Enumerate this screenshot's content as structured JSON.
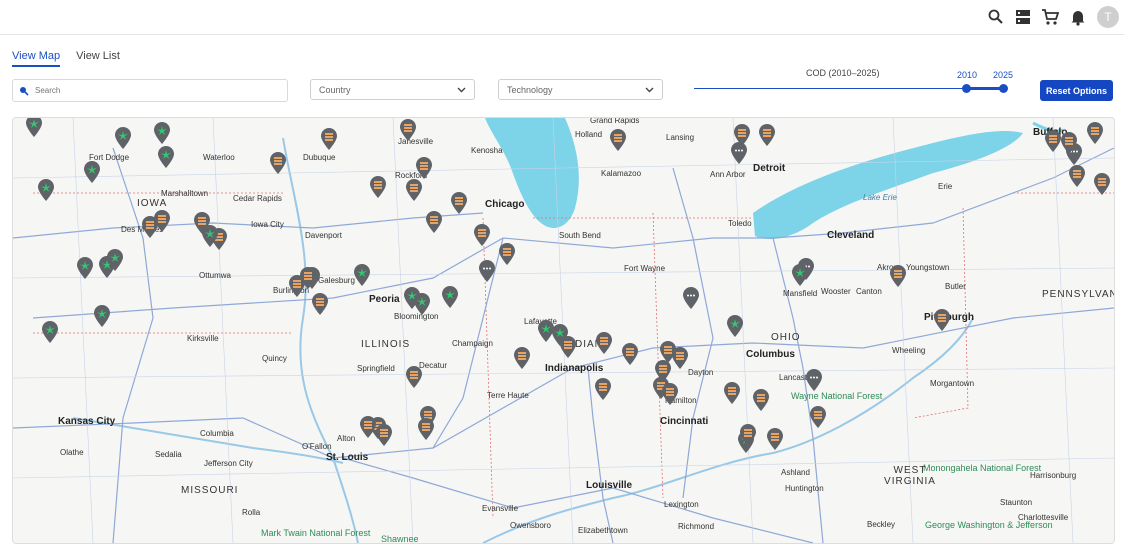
{
  "header": {
    "icons": [
      "search-icon",
      "server-icon",
      "cart-icon",
      "bell-icon"
    ],
    "avatar_initial": "T"
  },
  "tabs": [
    {
      "label": "View Map",
      "active": true
    },
    {
      "label": "View List",
      "active": false
    }
  ],
  "filters": {
    "search_placeholder": "Search",
    "country_label": "Country",
    "technology_label": "Technology",
    "cod_label": "COD (2010–2025)",
    "cod_min": "2010",
    "cod_max": "2025",
    "reset_label": "Reset Options"
  },
  "colors": {
    "accent": "#1a4fc4",
    "pin": "#5f6368",
    "wind_icon": "#2ecc71",
    "factory_icon": "#e8a363",
    "lake": "#7dd3e8"
  },
  "map": {
    "states": [
      "IOWA",
      "ILLINOIS",
      "INDIANA",
      "OHIO",
      "MISSOURI",
      "WEST VIRGINIA",
      "PENNSYLVANIA"
    ],
    "major_cities": [
      "Chicago",
      "Detroit",
      "Cleveland",
      "Indianapolis",
      "Columbus",
      "Cincinnati",
      "Kansas City",
      "St. Louis",
      "Louisville",
      "Pittsburgh"
    ],
    "cities": [
      "Fort Dodge",
      "Waterloo",
      "Dubuque",
      "Janesville",
      "Kenosha",
      "Holland",
      "Grand Rapids",
      "Lansing",
      "Marshalltown",
      "Cedar Rapids",
      "Rockford",
      "Kalamazoo",
      "Ann Arbor",
      "Buffalo",
      "Erie",
      "Des Moines",
      "Iowa City",
      "Davenport",
      "South Bend",
      "Toledo",
      "Ottumwa",
      "Galesburg",
      "Fort Wayne",
      "Akron",
      "Youngstown",
      "Burlington",
      "Peoria",
      "Mansfield",
      "Wooster",
      "Canton",
      "Butler",
      "Bloomington",
      "Kirksville",
      "Champaign",
      "Lafayette",
      "Springfield",
      "Decatur",
      "Wheeling",
      "Quincy",
      "Dayton",
      "Lancaster",
      "Morgantown",
      "Terre Haute",
      "Hamilton",
      "Columbia",
      "Olathe",
      "Alton",
      "Sedalia",
      "Jefferson City",
      "O'Fallon",
      "Huntington",
      "Ashland",
      "Harrisonburg",
      "Staunton",
      "Charlottesville",
      "Rolla",
      "Evansville",
      "Owensboro",
      "Elizabethtown",
      "Lexington",
      "Richmond",
      "Beckley",
      "Lake Erie",
      "Wayne National Forest",
      "Monongahela National Forest",
      "Mark Twain National Forest",
      "Shawnee",
      "George Washington & Jefferson"
    ],
    "pins": [
      {
        "type": "wind"
      },
      {
        "type": "wind"
      },
      {
        "type": "wind"
      },
      {
        "type": "wind"
      },
      {
        "type": "wind"
      },
      {
        "type": "wind"
      },
      {
        "type": "factory"
      },
      {
        "type": "factory"
      },
      {
        "type": "factory"
      },
      {
        "type": "factory"
      },
      {
        "type": "factory"
      },
      {
        "type": "factory"
      },
      {
        "type": "factory"
      },
      {
        "type": "factory"
      },
      {
        "type": "factory"
      },
      {
        "type": "factory"
      },
      {
        "type": "factory"
      },
      {
        "type": "factory"
      },
      {
        "type": "factory"
      },
      {
        "type": "wind"
      },
      {
        "type": "wind"
      },
      {
        "type": "wind"
      },
      {
        "type": "wind"
      },
      {
        "type": "factory"
      },
      {
        "type": "factory"
      },
      {
        "type": "factory"
      },
      {
        "type": "cluster"
      },
      {
        "type": "cluster"
      },
      {
        "type": "cluster"
      },
      {
        "type": "cluster"
      },
      {
        "type": "cluster"
      },
      {
        "type": "factory"
      },
      {
        "type": "factory"
      },
      {
        "type": "factory"
      },
      {
        "type": "factory"
      },
      {
        "type": "factory"
      },
      {
        "type": "wind"
      },
      {
        "type": "wind"
      },
      {
        "type": "wind"
      },
      {
        "type": "wind"
      },
      {
        "type": "factory"
      },
      {
        "type": "factory"
      },
      {
        "type": "factory"
      },
      {
        "type": "factory"
      },
      {
        "type": "wind"
      },
      {
        "type": "wind"
      },
      {
        "type": "factory"
      },
      {
        "type": "factory"
      },
      {
        "type": "factory"
      },
      {
        "type": "factory"
      },
      {
        "type": "factory"
      },
      {
        "type": "factory"
      },
      {
        "type": "wind"
      },
      {
        "type": "wind"
      },
      {
        "type": "wind"
      },
      {
        "type": "factory"
      },
      {
        "type": "factory"
      },
      {
        "type": "factory"
      },
      {
        "type": "factory"
      },
      {
        "type": "factory"
      },
      {
        "type": "cluster"
      },
      {
        "type": "factory"
      },
      {
        "type": "factory"
      },
      {
        "type": "wind"
      },
      {
        "type": "wind"
      },
      {
        "type": "factory"
      },
      {
        "type": "factory"
      },
      {
        "type": "factory"
      },
      {
        "type": "factory"
      },
      {
        "type": "factory"
      },
      {
        "type": "factory"
      },
      {
        "type": "factory"
      },
      {
        "type": "factory"
      },
      {
        "type": "wind"
      },
      {
        "type": "factory"
      },
      {
        "type": "factory"
      }
    ]
  }
}
